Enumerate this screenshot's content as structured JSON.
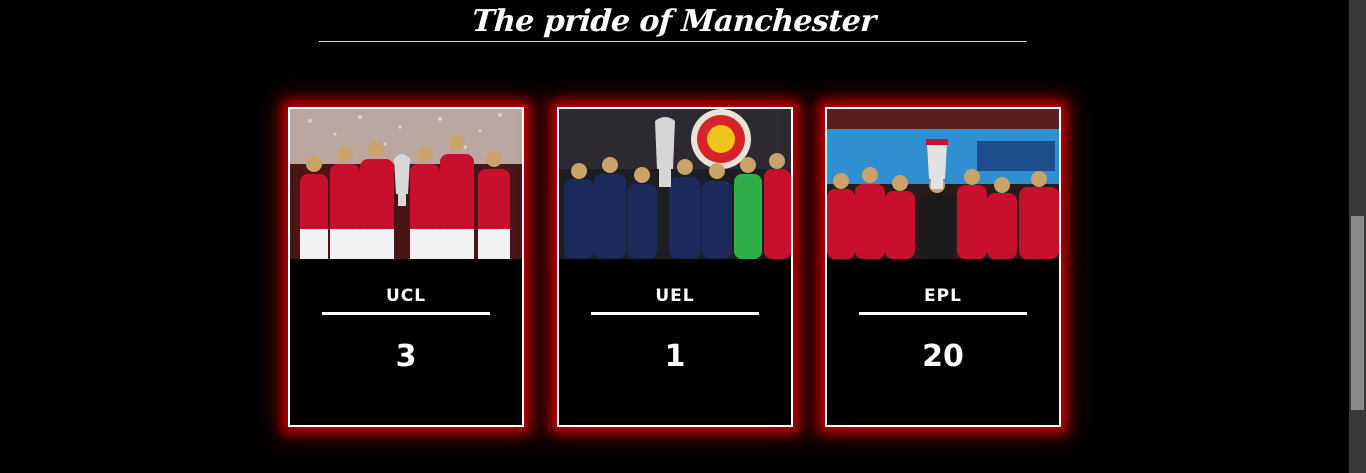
{
  "page": {
    "title": "The pride of Manchester"
  },
  "cards": [
    {
      "label": "UCL",
      "value": "3",
      "photo": "ucl-trophy-celebration-photo"
    },
    {
      "label": "UEL",
      "value": "1",
      "photo": "uel-trophy-celebration-photo"
    },
    {
      "label": "EPL",
      "value": "20",
      "photo": "epl-trophy-celebration-photo"
    }
  ],
  "colors": {
    "background": "#000000",
    "glow": "#cc0000",
    "text": "#ffffff",
    "kit_red": "#c8102e",
    "kit_navy": "#1b2a5a"
  }
}
